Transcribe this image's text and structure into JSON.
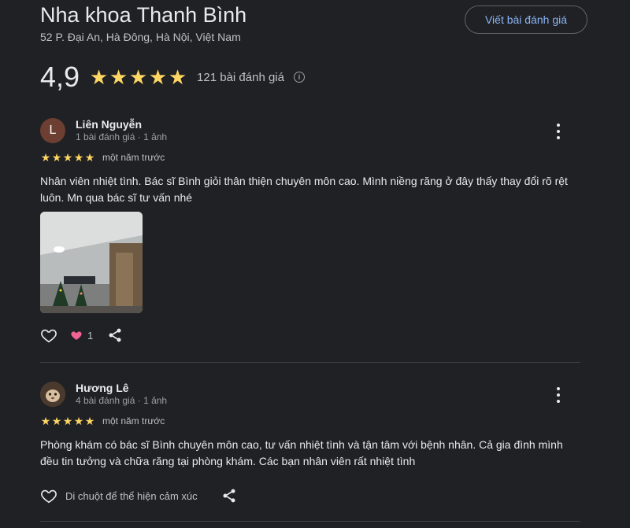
{
  "place": {
    "name": "Nha khoa Thanh Bình",
    "address": "52 P. Đại An, Hà Đông, Hà Nội, Việt Nam",
    "write_review_label": "Viết bài đánh giá"
  },
  "summary": {
    "rating": "4,9",
    "stars": 5,
    "review_count": "121 bài đánh giá",
    "star_color": "#fdd663"
  },
  "reviews": [
    {
      "avatar_letter": "L",
      "name": "Liên Nguyễn",
      "meta": "1 bài đánh giá · 1 ảnh",
      "stars": 5,
      "time": "một năm trước",
      "text": "Nhân viên nhiệt tình. Bác sĩ Bình giỏi thân thiện chuyên môn cao. Mình niềng răng ở đây thấy thay đổi rõ rệt luôn. Mn qua bác sĩ tư vấn nhé",
      "reaction_count": "1",
      "reaction_icon": "heart-filled-icon"
    },
    {
      "name": "Hương Lê",
      "meta": "4 bài đánh giá · 1 ảnh",
      "stars": 5,
      "time": "một năm trước",
      "text": "Phòng khám có bác sĩ Bình chuyên môn cao, tư vấn nhiệt tình và tận tâm với bệnh nhân. Cả gia đình mình đều tin tưởng và chữa răng tại phòng khám. Các bạn nhân viên rất nhiệt tình",
      "hover_hint": "Di chuột để thể hiện cảm xúc"
    }
  ],
  "colors": {
    "background": "#202124",
    "accent_link": "#8ab4f8",
    "heart": "#f06292"
  }
}
